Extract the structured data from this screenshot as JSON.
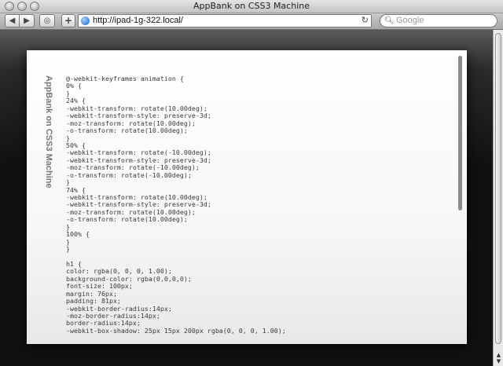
{
  "window": {
    "title": "AppBank on CSS3 Machine"
  },
  "toolbar": {
    "back_label": "◀",
    "forward_label": "▶",
    "history_label": "◎",
    "add_label": "+",
    "url": "http://ipad-1g-322.local/",
    "reload_label": "↻",
    "search_placeholder": "Google"
  },
  "page": {
    "side_label": "AppBank on CSS3 Machine",
    "code_lines": [
      "@-webkit-keyframes animation {",
      "0% {",
      "}",
      "24% {",
      "-webkit-transform: rotate(10.00deg);",
      "-webkit-transform-style: preserve-3d;",
      "-moz-transform: rotate(10.00deg);",
      "-o-transform: rotate(10.00deg);",
      "}",
      "50% {",
      "-webkit-transform: rotate(-10.00deg);",
      "-webkit-transform-style: preserve-3d;",
      "-moz-transform: rotate(-10.00deg);",
      "-o-transform: rotate(-10.00deg);",
      "}",
      "74% {",
      "-webkit-transform: rotate(10.00deg);",
      "-webkit-transform-style: preserve-3d;",
      "-moz-transform: rotate(10.00deg);",
      "-o-transform: rotate(10.00deg);",
      "}",
      "100% {",
      "}",
      "}",
      "",
      "h1 {",
      "color: rgba(0, 0, 0, 1.00);",
      "background-color: rgba(0,0,0,0);",
      "font-size: 100px;",
      "margin: 76px;",
      "padding: 81px;",
      "-webkit-border-radius:14px;",
      "-moz-border-radius:14px;",
      "border-radius:14px;",
      "-webkit-box-shadow: 25px 15px 200px rgba(0, 0, 0, 1.00);"
    ]
  },
  "colors": {
    "code_text": "#3b3b3b",
    "side_label": "#777777",
    "card_bg": "#ffffff"
  }
}
